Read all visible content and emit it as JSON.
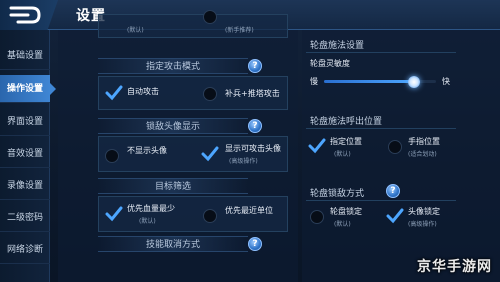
{
  "header": {
    "title": "设置"
  },
  "sidebar": {
    "items": [
      {
        "label": "基础设置"
      },
      {
        "label": "操作设置"
      },
      {
        "label": "界面设置"
      },
      {
        "label": "音效设置"
      },
      {
        "label": "录像设置"
      },
      {
        "label": "二级密码"
      },
      {
        "label": "网络诊断"
      }
    ],
    "active_index": 1
  },
  "left": {
    "top_partial": {
      "left_sub": "(默认)",
      "right_sub": "(新手推荐)"
    },
    "attack_target": {
      "heading": "指定攻击模式",
      "opt1_label": "自动攻击",
      "opt1_checked": true,
      "opt2_label": "补兵+推塔攻击",
      "opt2_checked": false
    },
    "lock_avatar": {
      "heading": "锁敌头像显示",
      "opt1_label": "不显示头像",
      "opt1_checked": false,
      "opt2_label": "显示可攻击头像",
      "opt2_sub": "(高级操作)",
      "opt2_checked": true
    },
    "target_filter": {
      "heading": "目标筛选",
      "opt1_label": "优先血量最少",
      "opt1_sub": "(默认)",
      "opt1_checked": true,
      "opt2_label": "优先最近单位",
      "opt2_checked": false
    },
    "skill_cancel": {
      "heading": "技能取消方式"
    }
  },
  "right": {
    "wheel_settings": {
      "heading": "轮盘施法设置",
      "sensitivity_label": "轮盘灵敏度",
      "slow_label": "慢",
      "fast_label": "快",
      "sensitivity_level": 0.8
    },
    "wheel_position": {
      "heading": "轮盘施法呼出位置",
      "opt1_label": "指定位置",
      "opt1_sub": "(默认)",
      "opt1_checked": true,
      "opt2_label": "手指位置",
      "opt2_sub": "(适合划动)",
      "opt2_checked": false
    },
    "wheel_lock": {
      "heading": "轮盘锁敌方式",
      "opt1_label": "轮盘锁定",
      "opt1_sub": "(默认)",
      "opt1_checked": false,
      "opt2_label": "头像锁定",
      "opt2_sub": "(高级操作)",
      "opt2_checked": true
    }
  },
  "help_symbol": "?",
  "watermark": "京华手游网",
  "colors": {
    "accent": "#3f86d4",
    "check": "#4da6ff"
  }
}
